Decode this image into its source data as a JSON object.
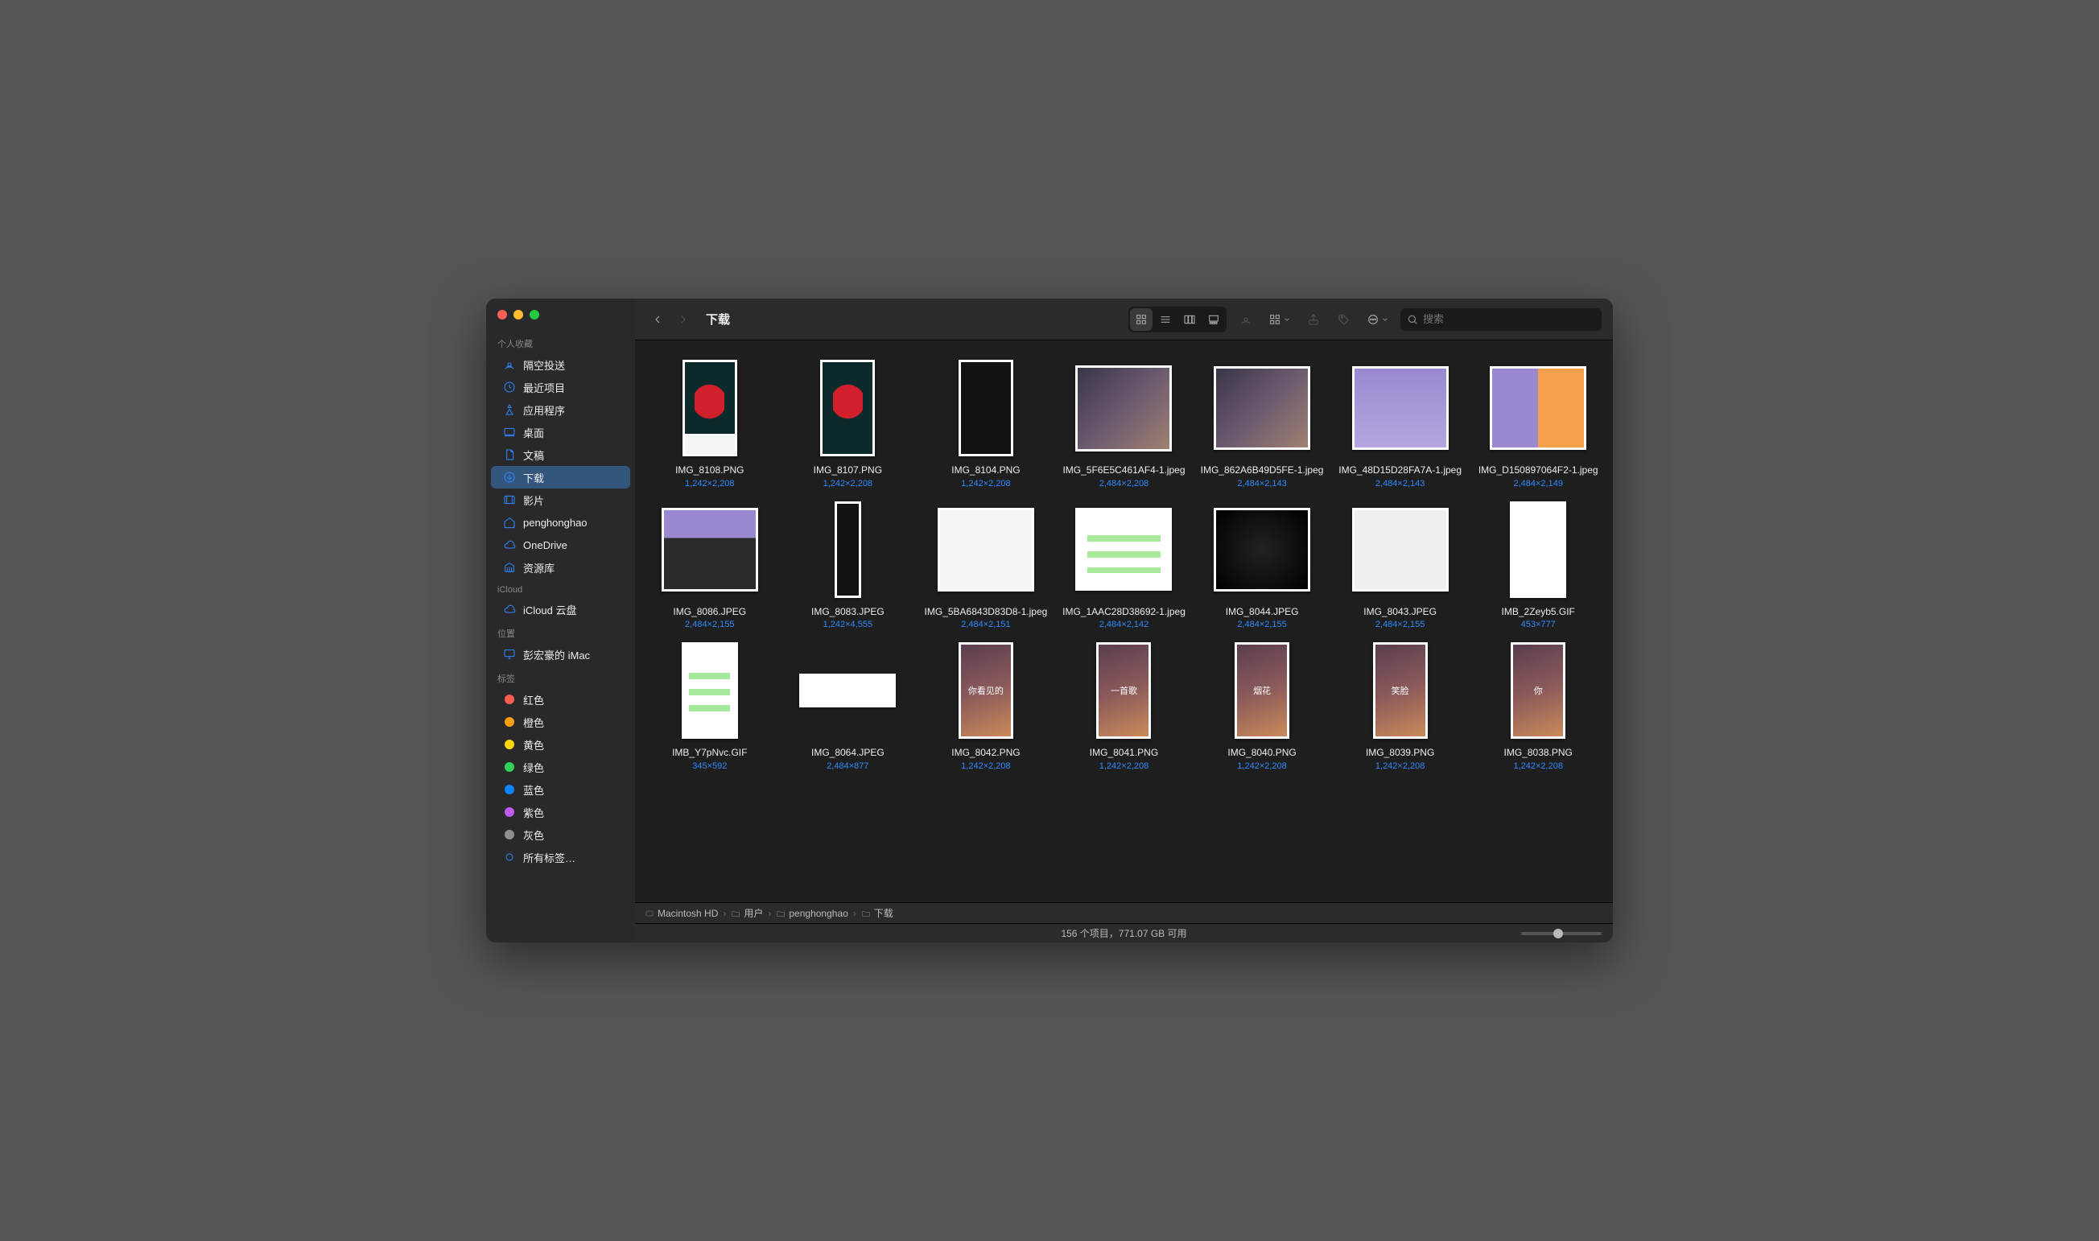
{
  "window": {
    "title": "下载"
  },
  "sidebar": {
    "sections": [
      {
        "label": "个人收藏",
        "items": [
          {
            "icon": "airdrop",
            "label": "隔空投送"
          },
          {
            "icon": "clock",
            "label": "最近项目"
          },
          {
            "icon": "apps",
            "label": "应用程序"
          },
          {
            "icon": "desktop",
            "label": "桌面"
          },
          {
            "icon": "doc",
            "label": "文稿"
          },
          {
            "icon": "download",
            "label": "下载",
            "selected": true
          },
          {
            "icon": "movie",
            "label": "影片"
          },
          {
            "icon": "home",
            "label": "penghonghao"
          },
          {
            "icon": "cloud",
            "label": "OneDrive"
          },
          {
            "icon": "library",
            "label": "资源库"
          }
        ]
      },
      {
        "label": "iCloud",
        "items": [
          {
            "icon": "cloud",
            "label": "iCloud 云盘"
          }
        ]
      },
      {
        "label": "位置",
        "items": [
          {
            "icon": "imac",
            "label": "彭宏豪的 iMac"
          }
        ]
      },
      {
        "label": "标签",
        "items": [
          {
            "icon": "tag",
            "color": "#ff5b50",
            "label": "红色"
          },
          {
            "icon": "tag",
            "color": "#ff9f0a",
            "label": "橙色"
          },
          {
            "icon": "tag",
            "color": "#ffd60a",
            "label": "黄色"
          },
          {
            "icon": "tag",
            "color": "#30d158",
            "label": "绿色"
          },
          {
            "icon": "tag",
            "color": "#0a84ff",
            "label": "蓝色"
          },
          {
            "icon": "tag",
            "color": "#bf5af2",
            "label": "紫色"
          },
          {
            "icon": "tag",
            "color": "#8e8e93",
            "label": "灰色"
          },
          {
            "icon": "alltags",
            "label": "所有标签…"
          }
        ]
      }
    ]
  },
  "search": {
    "placeholder": "搜索"
  },
  "pathbar": {
    "crumbs": [
      {
        "icon": "disk",
        "label": "Macintosh HD"
      },
      {
        "icon": "folder",
        "label": "用户"
      },
      {
        "icon": "folder",
        "label": "penghonghao"
      },
      {
        "icon": "folder",
        "label": "下载"
      }
    ]
  },
  "status": {
    "text": "156 个项目，771.07 GB 可用"
  },
  "files": [
    {
      "name": "IMG_8108.PNG",
      "dims": "1,242×2,208",
      "ratio": 0.5625,
      "art": "art-rose art-rose-bar"
    },
    {
      "name": "IMG_8107.PNG",
      "dims": "1,242×2,208",
      "ratio": 0.5625,
      "art": "art-rose"
    },
    {
      "name": "IMG_8104.PNG",
      "dims": "1,242×2,208",
      "ratio": 0.5625,
      "art": "art-dark"
    },
    {
      "name": "IMG_5F6E5C461AF4-1.jpeg",
      "dims": "2,484×2,208",
      "ratio": 1.125,
      "art": "art-wide-blur"
    },
    {
      "name": "IMG_862A6B49D5FE-1.jpeg",
      "dims": "2,484×2,143",
      "ratio": 1.159,
      "art": "art-wide-blur"
    },
    {
      "name": "IMG_48D15D28FA7A-1.jpeg",
      "dims": "2,484×2,143",
      "ratio": 1.159,
      "art": "art-purple"
    },
    {
      "name": "IMG_D150897064F2-1.jpeg",
      "dims": "2,484×2,149",
      "ratio": 1.156,
      "art": "art-purple2"
    },
    {
      "name": "IMG_8086.JPEG",
      "dims": "2,484×2,155",
      "ratio": 1.153,
      "art": "art-keyb"
    },
    {
      "name": "IMG_8083.JPEG",
      "dims": "1,242×4,555",
      "ratio": 0.2727,
      "art": "art-dark"
    },
    {
      "name": "IMG_5BA6843D83D8-1.jpeg",
      "dims": "2,484×2,151",
      "ratio": 1.155,
      "art": "art-chatlist"
    },
    {
      "name": "IMG_1AAC28D38692-1.jpeg",
      "dims": "2,484×2,142",
      "ratio": 1.16,
      "art": "art-chat"
    },
    {
      "name": "IMG_8044.JPEG",
      "dims": "2,484×2,155",
      "ratio": 1.153,
      "art": "art-ctrl"
    },
    {
      "name": "IMG_8043.JPEG",
      "dims": "2,484×2,155",
      "ratio": 1.153,
      "art": "art-docs"
    },
    {
      "name": "IMB_2Zeyb5.GIF",
      "dims": "453×777",
      "ratio": 0.583,
      "art": "art-emoji"
    },
    {
      "name": "IMB_Y7pNvc.GIF",
      "dims": "345×592",
      "ratio": 0.583,
      "art": "art-chat"
    },
    {
      "name": "IMG_8064.JPEG",
      "dims": "2,484×877",
      "ratio": 2.832,
      "art": "art-emoji"
    },
    {
      "name": "IMG_8042.PNG",
      "dims": "1,242×2,208",
      "ratio": 0.5625,
      "art": "art-grad",
      "caption": "你看见的"
    },
    {
      "name": "IMG_8041.PNG",
      "dims": "1,242×2,208",
      "ratio": 0.5625,
      "art": "art-grad",
      "caption": "一首歌"
    },
    {
      "name": "IMG_8040.PNG",
      "dims": "1,242×2,208",
      "ratio": 0.5625,
      "art": "art-grad",
      "caption": "烟花"
    },
    {
      "name": "IMG_8039.PNG",
      "dims": "1,242×2,208",
      "ratio": 0.5625,
      "art": "art-grad",
      "caption": "笑脸"
    },
    {
      "name": "IMG_8038.PNG",
      "dims": "1,242×2,208",
      "ratio": 0.5625,
      "art": "art-grad",
      "caption": "你"
    }
  ]
}
